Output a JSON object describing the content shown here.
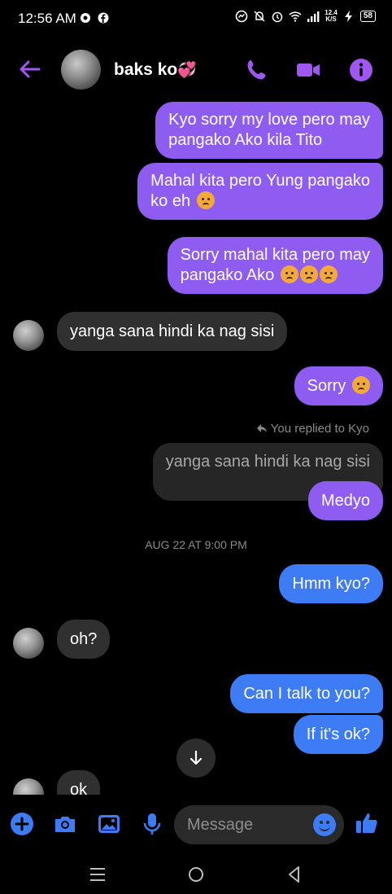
{
  "status_bar": {
    "time": "12:56 AM",
    "net_speed_top": "12.4",
    "net_speed_bottom": "K/S",
    "battery": "58"
  },
  "header": {
    "contact_name": "baks ko",
    "name_emoji": "💞",
    "accent_color": "#a056f0"
  },
  "messages": [
    {
      "text": "Kyo sorry my love pero may",
      "text2": "pangako Ako kila Tito"
    },
    {
      "text": "Mahal kita pero Yung pangako",
      "text2": "ko eh"
    },
    {
      "text": "Sorry mahal kita pero may",
      "text2": "pangako Ako"
    },
    {
      "text": "yanga sana hindi ka nag sisi"
    },
    {
      "text": "Sorry"
    },
    {
      "text": "Medyo"
    },
    {
      "text": "Hmm kyo?"
    },
    {
      "text": "oh?"
    },
    {
      "text": "Can  I talk to you?"
    },
    {
      "text": "If it's ok?"
    },
    {
      "text": "ok"
    }
  ],
  "reply": {
    "label": "You replied to Kyo",
    "quoted_text": "yanga sana hindi ka nag sisi"
  },
  "timestamp": "AUG 22 AT 9:00 PM",
  "composer": {
    "placeholder": "Message"
  },
  "colors": {
    "outgoing_purple": "#8e5cf0",
    "outgoing_blue": "#3d7cf5",
    "incoming": "#303030",
    "icon_blue": "#3d7cf5"
  }
}
